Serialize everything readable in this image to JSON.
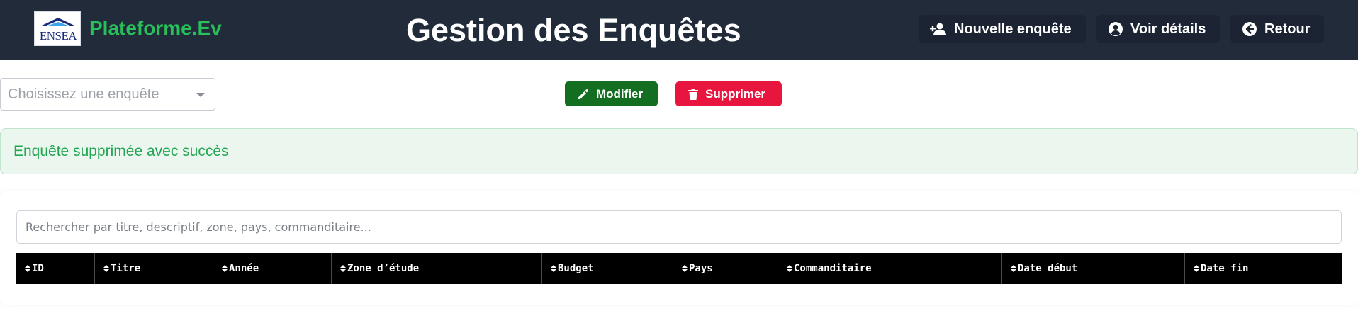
{
  "header": {
    "logo_text": "ENSEA",
    "brand": "Plateforme.Ev",
    "title": "Gestion des Enquêtes",
    "nav": [
      {
        "label": "Nouvelle enquête",
        "icon": "user-plus-icon"
      },
      {
        "label": "Voir détails",
        "icon": "user-circle-icon"
      },
      {
        "label": "Retour",
        "icon": "arrow-left-circle-icon"
      }
    ]
  },
  "toolbar": {
    "select_placeholder": "Choisissez une enquête",
    "edit_label": "Modifier",
    "delete_label": "Supprimer"
  },
  "alert": {
    "message": "Enquête supprimée avec succès"
  },
  "search": {
    "placeholder": "Rechercher par titre, descriptif, zone, pays, commanditaire..."
  },
  "table": {
    "columns": [
      "ID",
      "Titre",
      "Année",
      "Zone d’étude",
      "Budget",
      "Pays",
      "Commanditaire",
      "Date début",
      "Date fin"
    ]
  },
  "colors": {
    "header_bg": "#222b3a",
    "brand": "#27c05a",
    "edit_button": "#136e21",
    "delete_button": "#e8163f",
    "alert_bg": "#eaf6ee",
    "alert_text": "#23a553",
    "table_head": "#000000"
  }
}
